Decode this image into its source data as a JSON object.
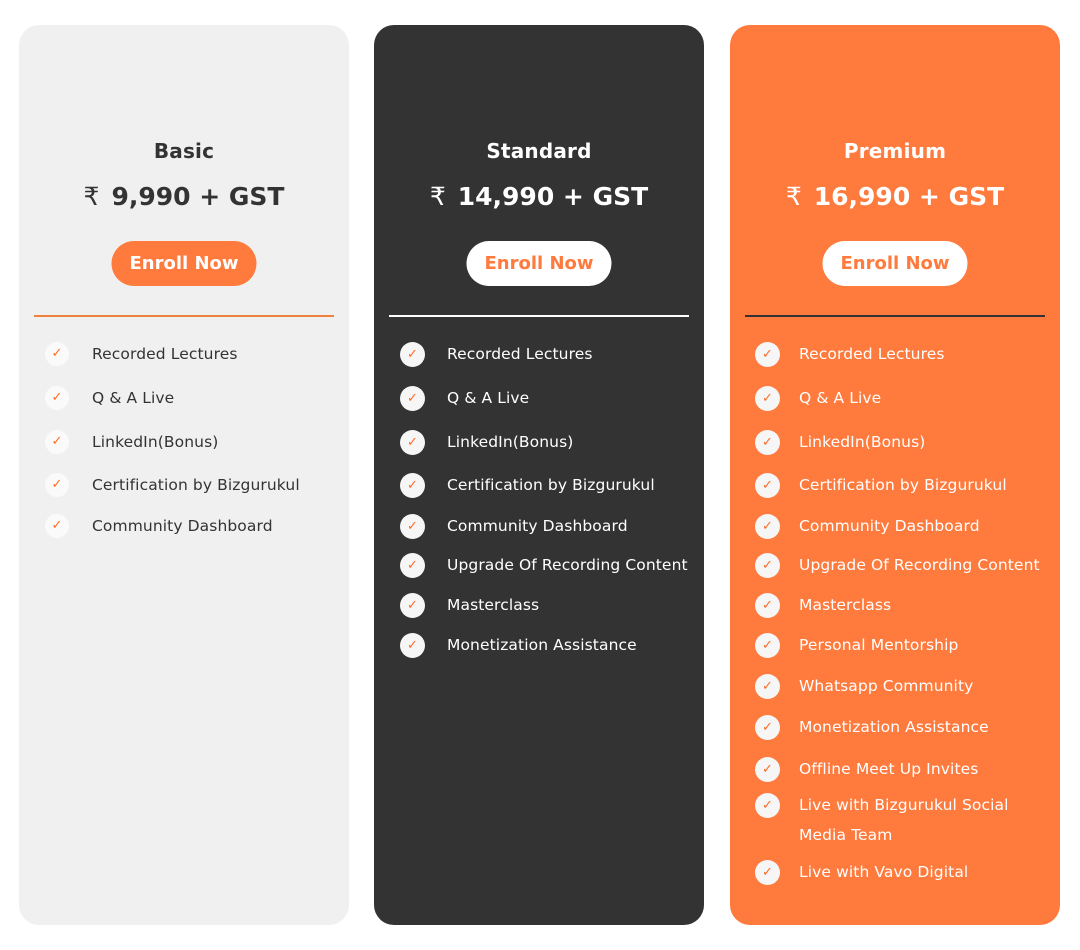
{
  "plans": {
    "basic": {
      "name": "Basic",
      "currency_symbol": "₹",
      "price": "9,990 + GST",
      "cta_label": "Enroll Now",
      "features": [
        "Recorded Lectures",
        "Q & A Live",
        "LinkedIn(Bonus)",
        "Certification by Bizgurukul",
        "Community Dashboard"
      ]
    },
    "standard": {
      "name": "Standard",
      "currency_symbol": "₹",
      "price": "14,990 + GST",
      "cta_label": "Enroll Now",
      "features": [
        "Recorded Lectures",
        "Q & A Live",
        "LinkedIn(Bonus)",
        "Certification by Bizgurukul",
        "Community Dashboard",
        "Upgrade Of Recording Content",
        "Masterclass",
        "Monetization Assistance"
      ]
    },
    "premium": {
      "name": "Premium",
      "currency_symbol": "₹",
      "price": "16,990 + GST",
      "cta_label": "Enroll Now",
      "features": [
        "Recorded Lectures",
        "Q & A Live",
        "LinkedIn(Bonus)",
        "Certification by Bizgurukul",
        "Community Dashboard",
        "Upgrade Of Recording Content",
        "Masterclass",
        "Personal Mentorship",
        "Whatsapp Community",
        "Monetization Assistance",
        "Offline Meet Up Invites",
        "Live with Bizgurukul Social Media Team",
        "Live with Vavo Digital"
      ]
    }
  },
  "icons": {
    "feature_check": "check-icon"
  },
  "colors": {
    "accent": "#ff7a3d",
    "basic_card": "#f0f0f0",
    "standard_card": "#333333",
    "premium_card": "#ff7a3d"
  }
}
